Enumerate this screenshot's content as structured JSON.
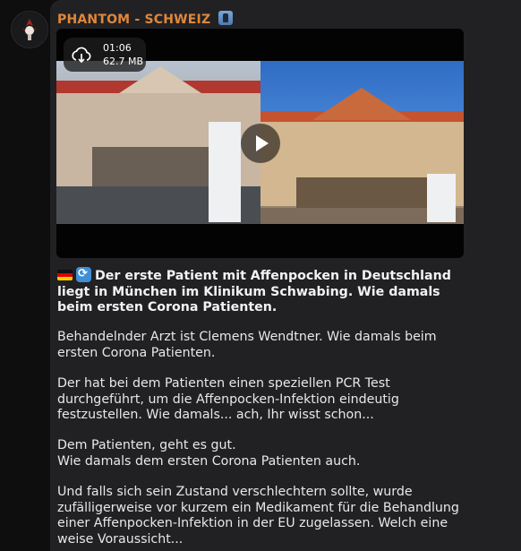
{
  "post": {
    "channel_name": "PHANTOM - SCHWEIZ",
    "channel_emoji": "man-office-worker",
    "video": {
      "duration": "01:06",
      "size": "62.7 MB"
    },
    "headline": "Der erste Patient mit Affenpocken in Deutschland liegt in München im Klinikum Schwabing. Wie damals beim ersten Corona Patienten.",
    "paragraphs": [
      "Behandelnder Arzt ist Clemens Wendtner. Wie damals beim ersten Corona Patienten.",
      "Der hat bei dem Patienten einen speziellen PCR Test durchgeführt, um die Affenpocken-Infektion eindeutig festzustellen. Wie damals... ach, Ihr wisst schon...",
      "Dem Patienten, geht es gut.\nWie damals dem ersten Corona Patienten auch.",
      "Und falls sich sein Zustand verschlechtern sollte, wurde zufälligerweise vor kurzem ein Medikament für die Behandlung einer Affenpocken-Infektion in der EU zugelassen. Welch eine weise Voraussicht..."
    ]
  },
  "colors": {
    "background": "#0e0e0f",
    "bubble": "#212124",
    "channel_name": "#e0873a"
  }
}
